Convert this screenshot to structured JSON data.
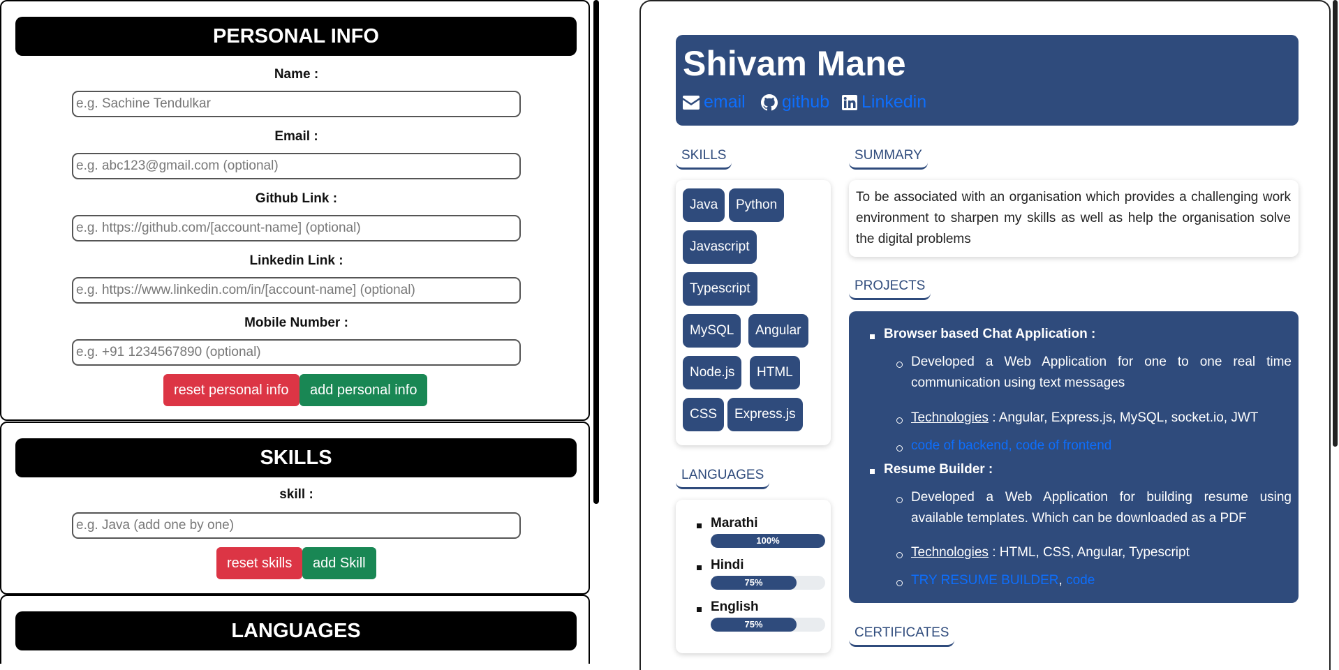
{
  "form": {
    "personal": {
      "header": "PERSONAL INFO",
      "name_label": "Name :",
      "name_placeholder": "e.g. Sachine Tendulkar",
      "email_label": "Email :",
      "email_placeholder": "e.g. abc123@gmail.com (optional)",
      "github_label": "Github Link :",
      "github_placeholder": "e.g. https://github.com/[account-name] (optional)",
      "linkedin_label": "Linkedin Link :",
      "linkedin_placeholder": "e.g. https://www.linkedin.com/in/[account-name] (optional)",
      "mobile_label": "Mobile Number :",
      "mobile_placeholder": "e.g. +91 1234567890 (optional)",
      "reset_label": "reset personal info",
      "add_label": "add personal info"
    },
    "skills": {
      "header": "SKILLS",
      "skill_label": "skill :",
      "skill_placeholder": "e.g. Java (add one by one)",
      "reset_label": "reset skills",
      "add_label": "add Skill"
    },
    "languages": {
      "header": "LANGUAGES"
    }
  },
  "resume": {
    "name": "Shivam Mane",
    "contacts": {
      "email": "email",
      "github": "github",
      "linkedin": "Linkedin"
    },
    "skills_title": "SKILLS",
    "skills": [
      "Java",
      "Python",
      "Javascript",
      "Typescript",
      "MySQL",
      "Angular",
      "Node.js",
      "HTML",
      "CSS",
      "Express.js"
    ],
    "languages_title": "LANGUAGES",
    "languages": [
      {
        "name": "Marathi",
        "percent_label": "100%",
        "level": 100
      },
      {
        "name": "Hindi",
        "percent_label": "75%",
        "level": 75
      },
      {
        "name": "English",
        "percent_label": "75%",
        "level": 75
      }
    ],
    "summary_title": "SUMMARY",
    "summary": "To be associated with an organisation which provides a challenging work environment to sharpen my skills as well as help the organisation solve the digital problems",
    "projects_title": "PROJECTS",
    "projects": [
      {
        "title": "Browser based Chat Application :",
        "description": "Developed a Web Application for one to one real time communication using text messages",
        "tech_label": "Technologies",
        "tech_value": " : Angular, Express.js, MySQL, socket.io, JWT",
        "link1": "code of backend",
        "separator": ", ",
        "link2": "code of frontend"
      },
      {
        "title": "Resume Builder :",
        "description": "Developed a Web Application for building resume using available templates. Which can be downloaded as a PDF",
        "tech_label": "Technologies",
        "tech_value": " : HTML, CSS, Angular, Typescript",
        "link1": "TRY RESUME BUILDER",
        "separator": ", ",
        "link2": "code"
      }
    ],
    "certificates_title": "CERTIFICATES"
  },
  "colors": {
    "navy": "#2f4b7c",
    "link_blue": "#0d6efd",
    "danger": "#dc3545",
    "success": "#198754"
  }
}
